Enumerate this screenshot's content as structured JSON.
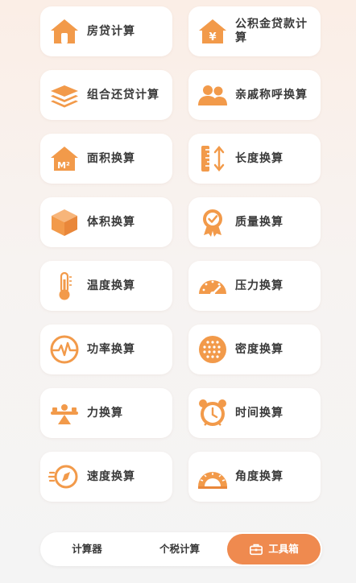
{
  "accent_color": "#f29a4a",
  "tools": [
    {
      "label": "房贷计算",
      "icon": "house-icon"
    },
    {
      "label": "公积金贷款计算",
      "icon": "house-yen-icon"
    },
    {
      "label": "组合还贷计算",
      "icon": "layers-icon"
    },
    {
      "label": "亲戚称呼换算",
      "icon": "people-icon"
    },
    {
      "label": "面积换算",
      "icon": "house-m2-icon"
    },
    {
      "label": "长度换算",
      "icon": "ruler-arrow-icon"
    },
    {
      "label": "体积换算",
      "icon": "cube-icon"
    },
    {
      "label": "质量换算",
      "icon": "badge-check-icon"
    },
    {
      "label": "温度换算",
      "icon": "thermometer-icon"
    },
    {
      "label": "压力换算",
      "icon": "gauge-icon"
    },
    {
      "label": "功率换算",
      "icon": "pulse-icon"
    },
    {
      "label": "密度换算",
      "icon": "dots-circle-icon"
    },
    {
      "label": "力换算",
      "icon": "balance-icon"
    },
    {
      "label": "时间换算",
      "icon": "alarm-clock-icon"
    },
    {
      "label": "速度换算",
      "icon": "compass-icon"
    },
    {
      "label": "角度换算",
      "icon": "protractor-icon"
    }
  ],
  "tabbar": {
    "calculator": "计算器",
    "tax": "个税计算",
    "toolbox": "工具箱",
    "active": "工具箱"
  }
}
